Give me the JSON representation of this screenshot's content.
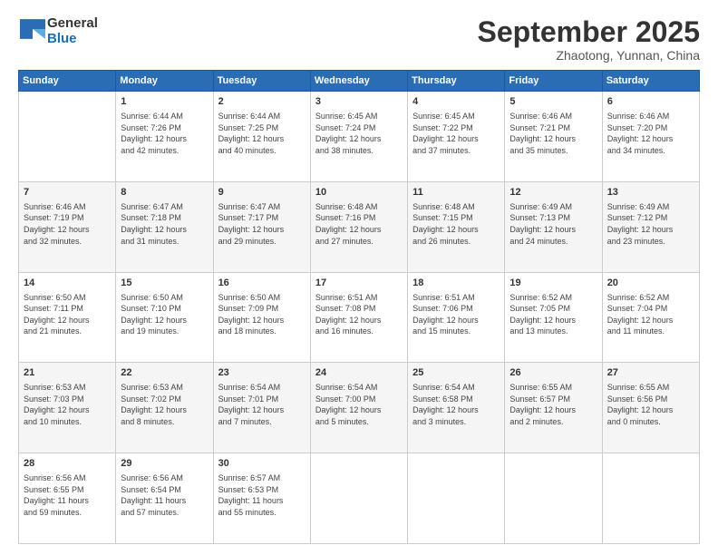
{
  "logo": {
    "line1": "General",
    "line2": "Blue"
  },
  "title": "September 2025",
  "subtitle": "Zhaotong, Yunnan, China",
  "days_of_week": [
    "Sunday",
    "Monday",
    "Tuesday",
    "Wednesday",
    "Thursday",
    "Friday",
    "Saturday"
  ],
  "weeks": [
    [
      {
        "day": "",
        "info": ""
      },
      {
        "day": "1",
        "info": "Sunrise: 6:44 AM\nSunset: 7:26 PM\nDaylight: 12 hours\nand 42 minutes."
      },
      {
        "day": "2",
        "info": "Sunrise: 6:44 AM\nSunset: 7:25 PM\nDaylight: 12 hours\nand 40 minutes."
      },
      {
        "day": "3",
        "info": "Sunrise: 6:45 AM\nSunset: 7:24 PM\nDaylight: 12 hours\nand 38 minutes."
      },
      {
        "day": "4",
        "info": "Sunrise: 6:45 AM\nSunset: 7:22 PM\nDaylight: 12 hours\nand 37 minutes."
      },
      {
        "day": "5",
        "info": "Sunrise: 6:46 AM\nSunset: 7:21 PM\nDaylight: 12 hours\nand 35 minutes."
      },
      {
        "day": "6",
        "info": "Sunrise: 6:46 AM\nSunset: 7:20 PM\nDaylight: 12 hours\nand 34 minutes."
      }
    ],
    [
      {
        "day": "7",
        "info": "Sunrise: 6:46 AM\nSunset: 7:19 PM\nDaylight: 12 hours\nand 32 minutes."
      },
      {
        "day": "8",
        "info": "Sunrise: 6:47 AM\nSunset: 7:18 PM\nDaylight: 12 hours\nand 31 minutes."
      },
      {
        "day": "9",
        "info": "Sunrise: 6:47 AM\nSunset: 7:17 PM\nDaylight: 12 hours\nand 29 minutes."
      },
      {
        "day": "10",
        "info": "Sunrise: 6:48 AM\nSunset: 7:16 PM\nDaylight: 12 hours\nand 27 minutes."
      },
      {
        "day": "11",
        "info": "Sunrise: 6:48 AM\nSunset: 7:15 PM\nDaylight: 12 hours\nand 26 minutes."
      },
      {
        "day": "12",
        "info": "Sunrise: 6:49 AM\nSunset: 7:13 PM\nDaylight: 12 hours\nand 24 minutes."
      },
      {
        "day": "13",
        "info": "Sunrise: 6:49 AM\nSunset: 7:12 PM\nDaylight: 12 hours\nand 23 minutes."
      }
    ],
    [
      {
        "day": "14",
        "info": "Sunrise: 6:50 AM\nSunset: 7:11 PM\nDaylight: 12 hours\nand 21 minutes."
      },
      {
        "day": "15",
        "info": "Sunrise: 6:50 AM\nSunset: 7:10 PM\nDaylight: 12 hours\nand 19 minutes."
      },
      {
        "day": "16",
        "info": "Sunrise: 6:50 AM\nSunset: 7:09 PM\nDaylight: 12 hours\nand 18 minutes."
      },
      {
        "day": "17",
        "info": "Sunrise: 6:51 AM\nSunset: 7:08 PM\nDaylight: 12 hours\nand 16 minutes."
      },
      {
        "day": "18",
        "info": "Sunrise: 6:51 AM\nSunset: 7:06 PM\nDaylight: 12 hours\nand 15 minutes."
      },
      {
        "day": "19",
        "info": "Sunrise: 6:52 AM\nSunset: 7:05 PM\nDaylight: 12 hours\nand 13 minutes."
      },
      {
        "day": "20",
        "info": "Sunrise: 6:52 AM\nSunset: 7:04 PM\nDaylight: 12 hours\nand 11 minutes."
      }
    ],
    [
      {
        "day": "21",
        "info": "Sunrise: 6:53 AM\nSunset: 7:03 PM\nDaylight: 12 hours\nand 10 minutes."
      },
      {
        "day": "22",
        "info": "Sunrise: 6:53 AM\nSunset: 7:02 PM\nDaylight: 12 hours\nand 8 minutes."
      },
      {
        "day": "23",
        "info": "Sunrise: 6:54 AM\nSunset: 7:01 PM\nDaylight: 12 hours\nand 7 minutes."
      },
      {
        "day": "24",
        "info": "Sunrise: 6:54 AM\nSunset: 7:00 PM\nDaylight: 12 hours\nand 5 minutes."
      },
      {
        "day": "25",
        "info": "Sunrise: 6:54 AM\nSunset: 6:58 PM\nDaylight: 12 hours\nand 3 minutes."
      },
      {
        "day": "26",
        "info": "Sunrise: 6:55 AM\nSunset: 6:57 PM\nDaylight: 12 hours\nand 2 minutes."
      },
      {
        "day": "27",
        "info": "Sunrise: 6:55 AM\nSunset: 6:56 PM\nDaylight: 12 hours\nand 0 minutes."
      }
    ],
    [
      {
        "day": "28",
        "info": "Sunrise: 6:56 AM\nSunset: 6:55 PM\nDaylight: 11 hours\nand 59 minutes."
      },
      {
        "day": "29",
        "info": "Sunrise: 6:56 AM\nSunset: 6:54 PM\nDaylight: 11 hours\nand 57 minutes."
      },
      {
        "day": "30",
        "info": "Sunrise: 6:57 AM\nSunset: 6:53 PM\nDaylight: 11 hours\nand 55 minutes."
      },
      {
        "day": "",
        "info": ""
      },
      {
        "day": "",
        "info": ""
      },
      {
        "day": "",
        "info": ""
      },
      {
        "day": "",
        "info": ""
      }
    ]
  ]
}
